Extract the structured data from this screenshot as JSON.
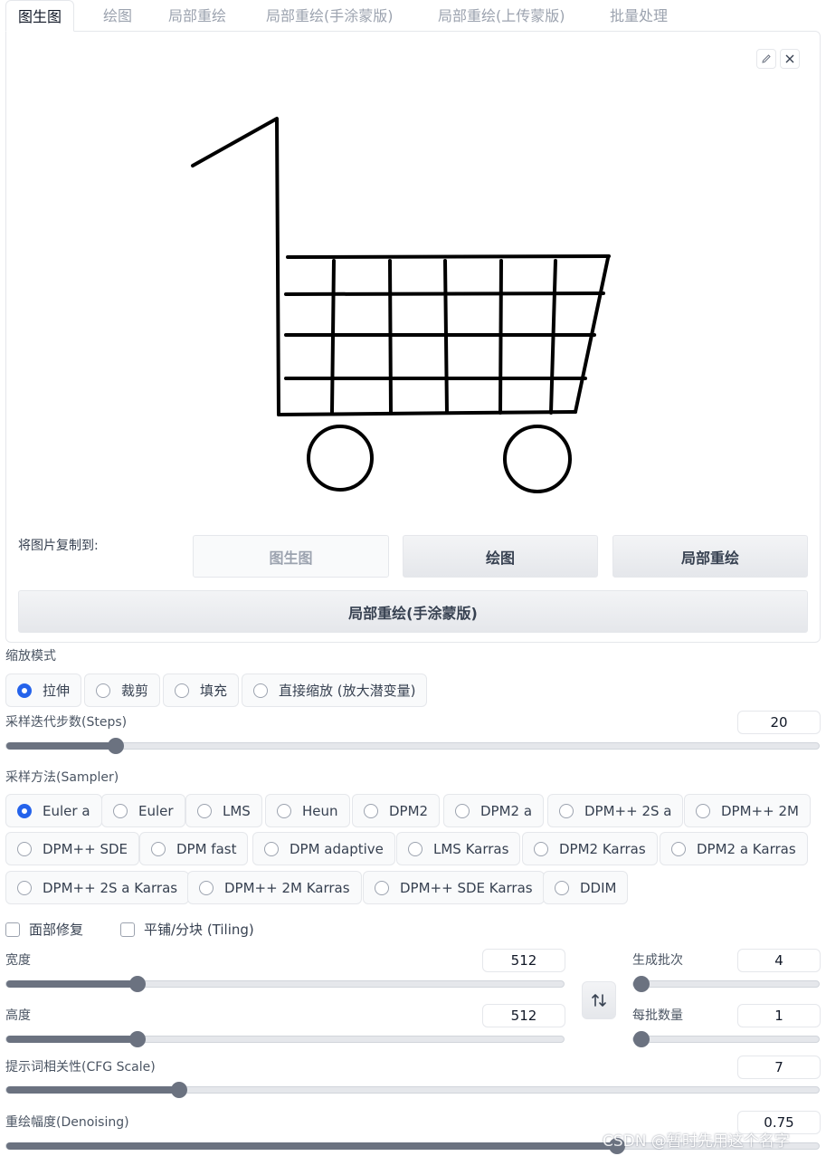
{
  "tabs": [
    {
      "label": "图生图"
    },
    {
      "label": "绘图"
    },
    {
      "label": "局部重绘"
    },
    {
      "label": "局部重绘(手涂蒙版)"
    },
    {
      "label": "局部重绘(上传蒙版)"
    },
    {
      "label": "批量处理"
    }
  ],
  "image_panel": {
    "edit_icon": "pencil-icon",
    "close_icon": "close-icon",
    "copy_to_label": "将图片复制到:",
    "copy_buttons": [
      "图生图",
      "绘图",
      "局部重绘"
    ],
    "copy_wide_button": "局部重绘(手涂蒙版)"
  },
  "resize_mode": {
    "label": "缩放模式",
    "options": [
      "拉伸",
      "裁剪",
      "填充",
      "直接缩放 (放大潜变量)"
    ],
    "selected": "拉伸"
  },
  "steps": {
    "label": "采样迭代步数(Steps)",
    "value": "20",
    "min": 1,
    "max": 150
  },
  "sampler": {
    "label": "采样方法(Sampler)",
    "options": [
      "Euler a",
      "Euler",
      "LMS",
      "Heun",
      "DPM2",
      "DPM2 a",
      "DPM++ 2S a",
      "DPM++ 2M",
      "DPM++ SDE",
      "DPM fast",
      "DPM adaptive",
      "LMS Karras",
      "DPM2 Karras",
      "DPM2 a Karras",
      "DPM++ 2S a Karras",
      "DPM++ 2M Karras",
      "DPM++ SDE Karras",
      "DDIM"
    ],
    "selected": "Euler a"
  },
  "checkboxes": {
    "face_restore": "面部修复",
    "tiling": "平铺/分块 (Tiling)"
  },
  "width": {
    "label": "宽度",
    "value": "512",
    "fraction": 0.235
  },
  "height": {
    "label": "高度",
    "value": "512",
    "fraction": 0.235
  },
  "batch_count": {
    "label": "生成批次",
    "value": "4",
    "fraction": 0.015
  },
  "batch_size": {
    "label": "每批数量",
    "value": "1",
    "fraction": 0.0
  },
  "swap_icon": "swap-vertical-icon",
  "cfg": {
    "label": "提示词相关性(CFG Scale)",
    "value": "7",
    "fraction": 0.212
  },
  "denoising": {
    "label": "重绘幅度(Denoising)",
    "value": "0.75",
    "fraction": 0.75
  },
  "watermark": "CSDN @暂时先用这个名字"
}
